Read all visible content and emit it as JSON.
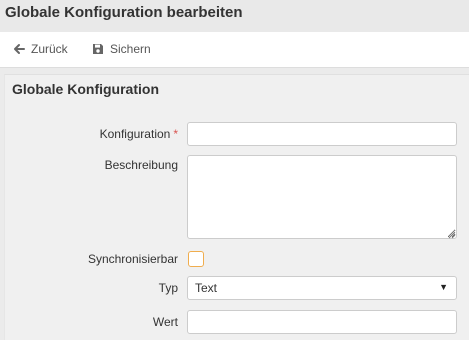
{
  "page": {
    "title": "Globale Konfiguration bearbeiten"
  },
  "toolbar": {
    "back_label": "Zurück",
    "back_icon": "arrow-left-icon",
    "save_label": "Sichern",
    "save_icon": "floppy-disk-icon"
  },
  "form": {
    "title": "Globale Konfiguration",
    "konfiguration": {
      "label": "Konfiguration",
      "required_marker": "*",
      "value": ""
    },
    "beschreibung": {
      "label": "Beschreibung",
      "value": ""
    },
    "synchronisierbar": {
      "label": "Synchronisierbar",
      "checked": false
    },
    "typ": {
      "label": "Typ",
      "selected": "Text"
    },
    "wert": {
      "label": "Wert",
      "value": ""
    }
  },
  "colors": {
    "required": "#d9534f",
    "checkbox_border": "#f0ad4e",
    "header_bg": "#e9e9e9",
    "panel_bg": "#f0f0f0"
  }
}
